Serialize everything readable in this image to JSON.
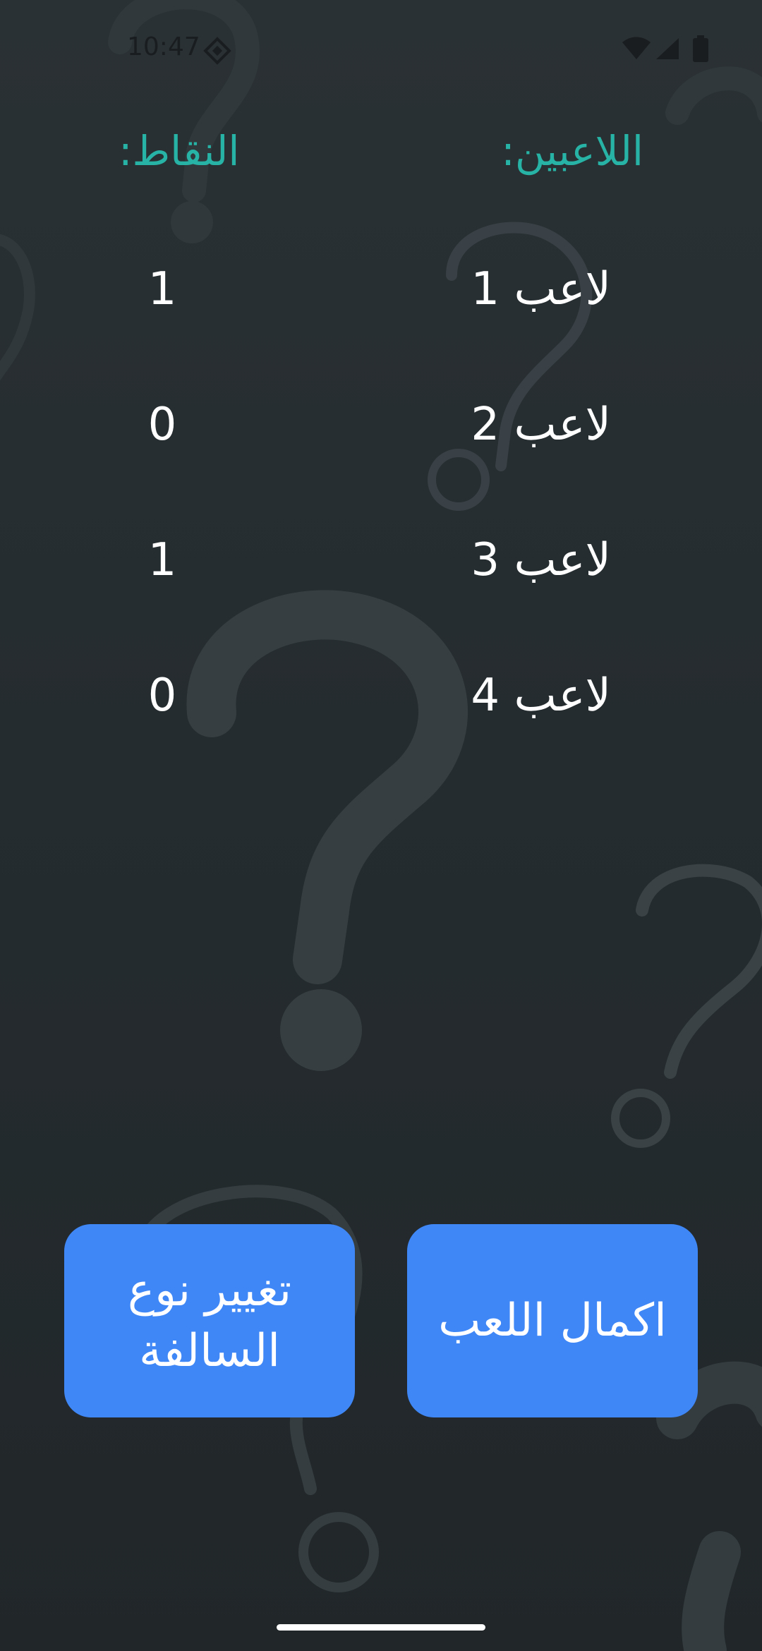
{
  "status_bar": {
    "time": "10:47",
    "icons": [
      "location-diamond-icon",
      "wifi-icon",
      "signal-icon",
      "battery-icon"
    ]
  },
  "headers": {
    "players": "اللاعبين:",
    "points": "النقاط:"
  },
  "players": [
    {
      "name": "لاعب 1",
      "score": "1"
    },
    {
      "name": "لاعب 2",
      "score": "0"
    },
    {
      "name": "لاعب 3",
      "score": "1"
    },
    {
      "name": "لاعب 4",
      "score": "0"
    }
  ],
  "buttons": {
    "change_category": "تغيير نوع السالفة",
    "continue_game": "اكمال اللعب"
  },
  "colors": {
    "header_text": "#27b3a5",
    "button_bg": "#3f87f7",
    "background": "#262d31"
  }
}
